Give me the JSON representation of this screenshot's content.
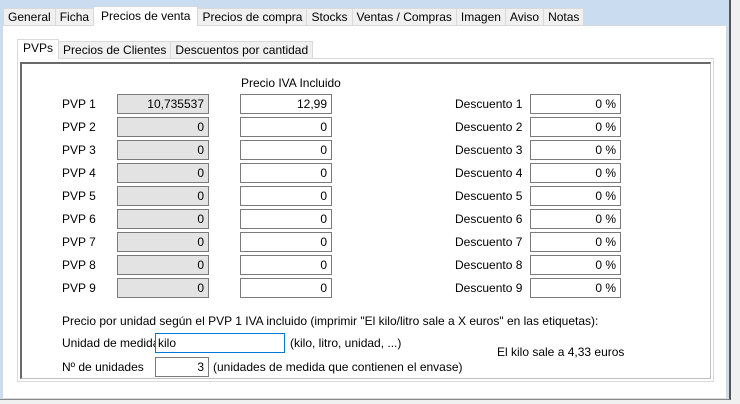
{
  "tabs": [
    "General",
    "Ficha",
    "Precios de venta",
    "Precios de compra",
    "Stocks",
    "Ventas / Compras",
    "Imagen",
    "Aviso",
    "Notas"
  ],
  "active_tab": "Precios de venta",
  "inner_tabs": [
    "PVPs",
    "Precios de Clientes",
    "Descuentos por cantidad"
  ],
  "column_header": "Precio IVA Incluido",
  "rows": [
    {
      "label": "PVP 1",
      "base": "10,735537",
      "iva": "12,99",
      "disc_label": "Descuento 1",
      "disc": "0 %"
    },
    {
      "label": "PVP 2",
      "base": "0",
      "iva": "0",
      "disc_label": "Descuento 2",
      "disc": "0 %"
    },
    {
      "label": "PVP 3",
      "base": "0",
      "iva": "0",
      "disc_label": "Descuento 3",
      "disc": "0 %"
    },
    {
      "label": "PVP 4",
      "base": "0",
      "iva": "0",
      "disc_label": "Descuento 4",
      "disc": "0 %"
    },
    {
      "label": "PVP 5",
      "base": "0",
      "iva": "0",
      "disc_label": "Descuento 5",
      "disc": "0 %"
    },
    {
      "label": "PVP 6",
      "base": "0",
      "iva": "0",
      "disc_label": "Descuento 6",
      "disc": "0 %"
    },
    {
      "label": "PVP 7",
      "base": "0",
      "iva": "0",
      "disc_label": "Descuento 7",
      "disc": "0 %"
    },
    {
      "label": "PVP 8",
      "base": "0",
      "iva": "0",
      "disc_label": "Descuento 8",
      "disc": "0 %"
    },
    {
      "label": "PVP 9",
      "base": "0",
      "iva": "0",
      "disc_label": "Descuento 9",
      "disc": "0 %"
    }
  ],
  "unit_section": {
    "title": "Precio por unidad según el PVP 1 IVA incluido (imprimir \"El kilo/litro sale a X euros\" en las etiquetas):",
    "unit_label": "Unidad de medida",
    "unit_value": "kilo",
    "unit_hint": "(kilo, litro, unidad, ...)",
    "count_label": "Nº de unidades",
    "count_value": "3",
    "count_hint": "(unidades de medida que contienen el envase)",
    "result": "El kilo sale a 4,33 euros"
  }
}
